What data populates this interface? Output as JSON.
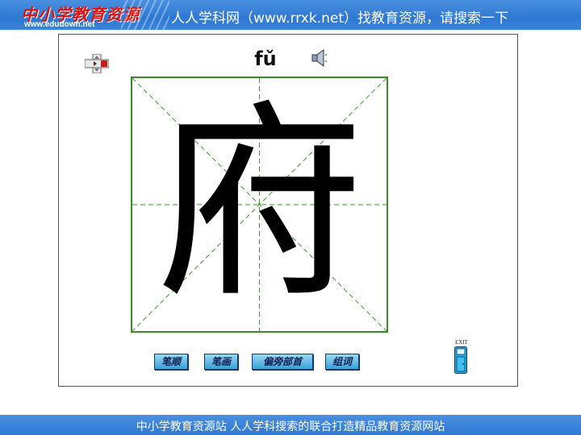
{
  "header": {
    "logo_title": "中小学教育资源",
    "logo_url": "www.edudown.net",
    "banner_text": "人人学科网（www.rrxk.net）找教育资源，请搜索一下"
  },
  "lesson": {
    "pinyin": "fǔ",
    "character": "府",
    "buttons": [
      {
        "label": "笔顺"
      },
      {
        "label": "笔画"
      },
      {
        "label": "偏旁部首"
      },
      {
        "label": "组词"
      }
    ],
    "exit_label": "EXIT"
  },
  "icons": {
    "navigation": "navigation-cross-icon",
    "speaker": "speaker-icon",
    "exit": "exit-door-icon"
  },
  "colors": {
    "banner_blue": "#2f78d2",
    "grid_green": "#3a8a2a",
    "logo_red": "#e01010",
    "button_blue": "#3aa0d8"
  },
  "footer": {
    "text": "中小学教育资源站 人人学科搜索的联合打造精品教育资源网站"
  }
}
